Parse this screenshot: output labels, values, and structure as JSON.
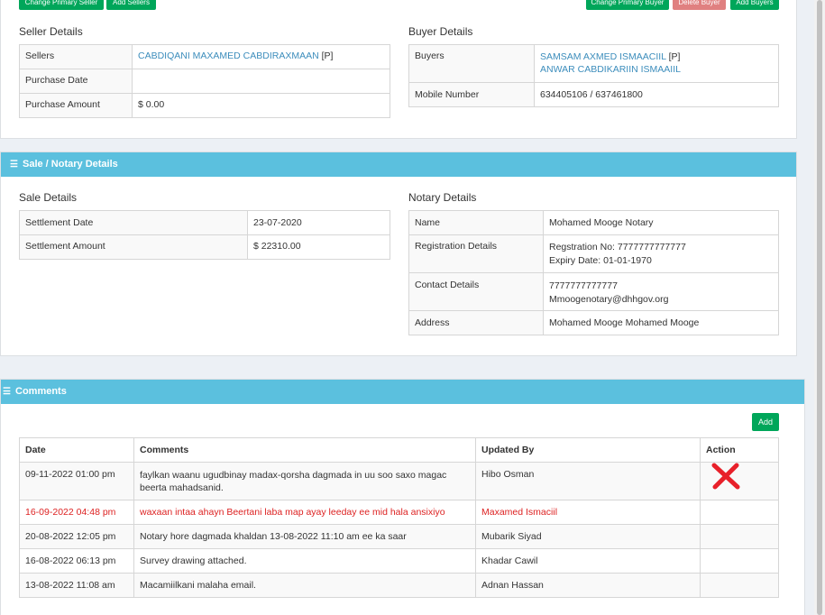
{
  "top_buttons": {
    "change_primary_seller": "Change Primary Seller",
    "add_sellers": "Add Sellers",
    "change_primary_buyer": "Change Primary Buyer",
    "delete_buyer": "Delete Buyer",
    "add_buyers": "Add Buyers"
  },
  "seller_details": {
    "title": "Seller Details",
    "sellers_label": "Sellers",
    "seller_name": "CABDIQANI MAXAMED CABDIRAXMAAN",
    "seller_flag": "[P]",
    "purchase_date_label": "Purchase Date",
    "purchase_date_value": "",
    "purchase_amount_label": "Purchase Amount",
    "purchase_amount_value": "$ 0.00"
  },
  "buyer_details": {
    "title": "Buyer Details",
    "buyers_label": "Buyers",
    "buyer_1": "SAMSAM AXMED ISMAACIIL",
    "buyer_1_flag": "[P]",
    "buyer_2": "ANWAR CABDIKARIIN ISMAAIIL",
    "mobile_label": "Mobile Number",
    "mobile_value": "634405106 / 637461800"
  },
  "sale_notary_panel": {
    "header": "Sale / Notary Details",
    "sale_title": "Sale Details",
    "settlement_date_label": "Settlement Date",
    "settlement_date_value": "23-07-2020",
    "settlement_amount_label": "Settlement Amount",
    "settlement_amount_value": "$ 22310.00",
    "notary_title": "Notary Details",
    "name_label": "Name",
    "name_value": "Mohamed Mooge Notary",
    "registration_label": "Registration Details",
    "registration_line1": "Regstration No: 7777777777777",
    "registration_line2": "Expiry Date: 01-01-1970",
    "contact_label": "Contact Details",
    "contact_line1": "7777777777777",
    "contact_line2": "Mmoogenotary@dhhgov.org",
    "address_label": "Address",
    "address_value": "Mohamed Mooge Mohamed Mooge"
  },
  "comments_panel": {
    "header": "Comments",
    "add_button": "Add",
    "columns": [
      "Date",
      "Comments",
      "Updated By",
      "Action"
    ],
    "rows": [
      {
        "date": "09-11-2022 01:00 pm",
        "comment": "faylkan waanu ugudbinay madax-qorsha dagmada in uu soo saxo magac beerta mahadsanid.",
        "updated_by": "Hibo Osman"
      },
      {
        "date": "16-09-2022 04:48 pm",
        "comment": "waxaan intaa ahayn Beertani laba map ayay leeday ee mid hala ansixiyo",
        "updated_by": "Maxamed Ismaciil"
      },
      {
        "date": "20-08-2022 12:05 pm",
        "comment": "Notary hore dagmada khaldan 13-08-2022 11:10 am ee ka saar",
        "updated_by": "Mubarik Siyad"
      },
      {
        "date": "16-08-2022 06:13 pm",
        "comment": "Survey drawing attached.",
        "updated_by": "Khadar Cawil"
      },
      {
        "date": "13-08-2022 11:08 am",
        "comment": "Macamiilkani malaha email.",
        "updated_by": "Adnan Hassan"
      }
    ]
  },
  "colors": {
    "panel_header": "#5bc0de",
    "button_green": "#00a65a",
    "button_red": "#e08080",
    "link": "#3c8dbc",
    "highlight_text": "#dd2222"
  }
}
